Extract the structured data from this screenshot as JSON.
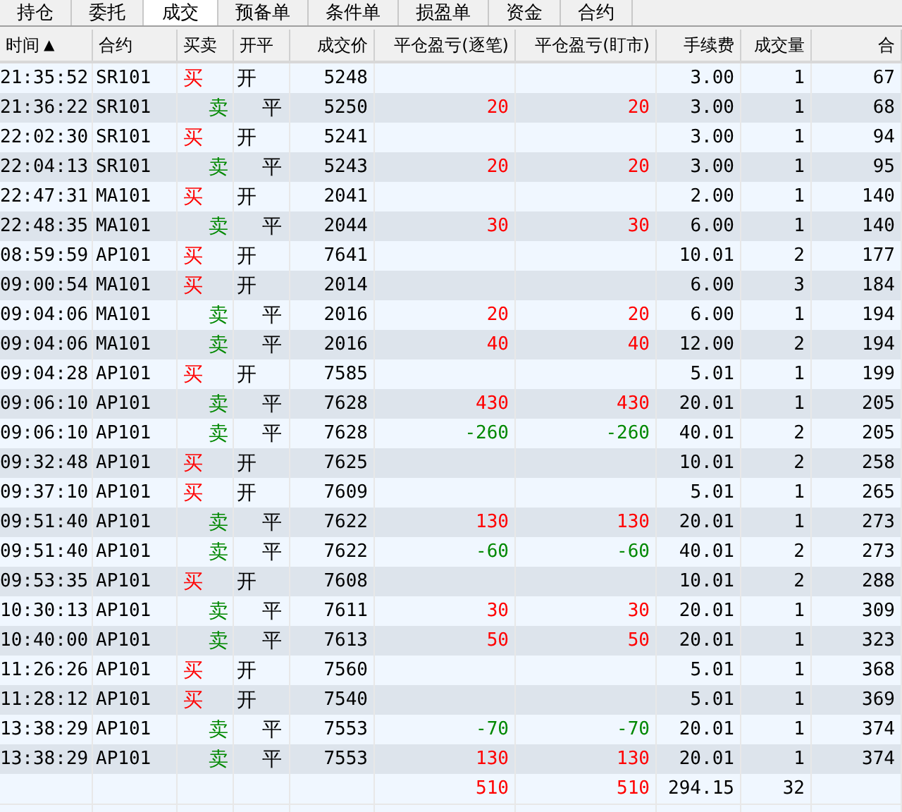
{
  "tabs": [
    {
      "label": "持仓",
      "selected": false
    },
    {
      "label": "委托",
      "selected": false
    },
    {
      "label": "成交",
      "selected": true
    },
    {
      "label": "预备单",
      "selected": false
    },
    {
      "label": "条件单",
      "selected": false
    },
    {
      "label": "损盈单",
      "selected": false
    },
    {
      "label": "资金",
      "selected": false
    },
    {
      "label": "合约",
      "selected": false
    }
  ],
  "table": {
    "columns": [
      {
        "label": "时间",
        "sort_mark": "▲"
      },
      {
        "label": "合约"
      },
      {
        "label": "买卖"
      },
      {
        "label": "开平"
      },
      {
        "label": "成交价"
      },
      {
        "label": "平仓盈亏(逐笔)"
      },
      {
        "label": "平仓盈亏(盯市)"
      },
      {
        "label": "手续费"
      },
      {
        "label": "成交量"
      },
      {
        "label": "合"
      }
    ],
    "rows": [
      {
        "kind": "buy",
        "time": "21:35:52",
        "contract": "SR101",
        "side": "买",
        "offset": "开",
        "price": "5248",
        "fee": "3.00",
        "volume": "1",
        "column_10": "67"
      },
      {
        "kind": "sell",
        "time": "21:36:22",
        "contract": "SR101",
        "side": "卖",
        "offset": "平",
        "price": "5250",
        "pnl_trade": "20",
        "pnl_mark": "20",
        "color": "#ff0000",
        "fee": "3.00",
        "volume": "1",
        "column_10": "68"
      },
      {
        "kind": "buy",
        "time": "22:02:30",
        "contract": "SR101",
        "side": "买",
        "offset": "开",
        "price": "5241",
        "fee": "3.00",
        "volume": "1",
        "column_10": "94"
      },
      {
        "kind": "sell",
        "time": "22:04:13",
        "contract": "SR101",
        "side": "卖",
        "offset": "平",
        "price": "5243",
        "pnl_trade": "20",
        "pnl_mark": "20",
        "color": "#ff0000",
        "fee": "3.00",
        "volume": "1",
        "column_10": "95"
      },
      {
        "kind": "buy",
        "time": "22:47:31",
        "contract": "MA101",
        "side": "买",
        "offset": "开",
        "price": "2041",
        "fee": "2.00",
        "volume": "1",
        "column_10": "140"
      },
      {
        "kind": "sell",
        "time": "22:48:35",
        "contract": "MA101",
        "side": "卖",
        "offset": "平",
        "price": "2044",
        "pnl_trade": "30",
        "pnl_mark": "30",
        "color": "#ff0000",
        "fee": "6.00",
        "volume": "1",
        "column_10": "140"
      },
      {
        "kind": "buy",
        "time": "08:59:59",
        "contract": "AP101",
        "side": "买",
        "offset": "开",
        "price": "7641",
        "fee": "10.01",
        "volume": "2",
        "column_10": "177"
      },
      {
        "kind": "buy",
        "time": "09:00:54",
        "contract": "MA101",
        "side": "买",
        "offset": "开",
        "price": "2014",
        "fee": "6.00",
        "volume": "3",
        "column_10": "184"
      },
      {
        "kind": "sell",
        "time": "09:04:06",
        "contract": "MA101",
        "side": "卖",
        "offset": "平",
        "price": "2016",
        "pnl_trade": "20",
        "pnl_mark": "20",
        "color": "#ff0000",
        "fee": "6.00",
        "volume": "1",
        "column_10": "194"
      },
      {
        "kind": "sell",
        "time": "09:04:06",
        "contract": "MA101",
        "side": "卖",
        "offset": "平",
        "price": "2016",
        "pnl_trade": "40",
        "pnl_mark": "40",
        "color": "#ff0000",
        "fee": "12.00",
        "volume": "2",
        "column_10": "194"
      },
      {
        "kind": "buy",
        "time": "09:04:28",
        "contract": "AP101",
        "side": "买",
        "offset": "开",
        "price": "7585",
        "fee": "5.01",
        "volume": "1",
        "column_10": "199"
      },
      {
        "kind": "sell",
        "time": "09:06:10",
        "contract": "AP101",
        "side": "卖",
        "offset": "平",
        "price": "7628",
        "pnl_trade": "430",
        "pnl_mark": "430",
        "color": "#ff0000",
        "fee": "20.01",
        "volume": "1",
        "column_10": "205"
      },
      {
        "kind": "sell",
        "time": "09:06:10",
        "contract": "AP101",
        "side": "卖",
        "offset": "平",
        "price": "7628",
        "pnl_trade": "-260",
        "pnl_mark": "-260",
        "color": "#008800",
        "fee": "40.01",
        "volume": "2",
        "column_10": "205"
      },
      {
        "kind": "buy",
        "time": "09:32:48",
        "contract": "AP101",
        "side": "买",
        "offset": "开",
        "price": "7625",
        "fee": "10.01",
        "volume": "2",
        "column_10": "258"
      },
      {
        "kind": "buy",
        "time": "09:37:10",
        "contract": "AP101",
        "side": "买",
        "offset": "开",
        "price": "7609",
        "fee": "5.01",
        "volume": "1",
        "column_10": "265"
      },
      {
        "kind": "sell",
        "time": "09:51:40",
        "contract": "AP101",
        "side": "卖",
        "offset": "平",
        "price": "7622",
        "pnl_trade": "130",
        "pnl_mark": "130",
        "color": "#ff0000",
        "fee": "20.01",
        "volume": "1",
        "column_10": "273"
      },
      {
        "kind": "sell",
        "time": "09:51:40",
        "contract": "AP101",
        "side": "卖",
        "offset": "平",
        "price": "7622",
        "pnl_trade": "-60",
        "pnl_mark": "-60",
        "color": "#008800",
        "fee": "40.01",
        "volume": "2",
        "column_10": "273"
      },
      {
        "kind": "buy",
        "time": "09:53:35",
        "contract": "AP101",
        "side": "买",
        "offset": "开",
        "price": "7608",
        "fee": "10.01",
        "volume": "2",
        "column_10": "288"
      },
      {
        "kind": "sell",
        "time": "10:30:13",
        "contract": "AP101",
        "side": "卖",
        "offset": "平",
        "price": "7611",
        "pnl_trade": "30",
        "pnl_mark": "30",
        "color": "#ff0000",
        "fee": "20.01",
        "volume": "1",
        "column_10": "309"
      },
      {
        "kind": "sell",
        "time": "10:40:00",
        "contract": "AP101",
        "side": "卖",
        "offset": "平",
        "price": "7613",
        "pnl_trade": "50",
        "pnl_mark": "50",
        "color": "#ff0000",
        "fee": "20.01",
        "volume": "1",
        "column_10": "323"
      },
      {
        "kind": "buy",
        "time": "11:26:26",
        "contract": "AP101",
        "side": "买",
        "offset": "开",
        "price": "7560",
        "fee": "5.01",
        "volume": "1",
        "column_10": "368"
      },
      {
        "kind": "buy",
        "time": "11:28:12",
        "contract": "AP101",
        "side": "买",
        "offset": "开",
        "price": "7540",
        "fee": "5.01",
        "volume": "1",
        "column_10": "369"
      },
      {
        "kind": "sell",
        "time": "13:38:29",
        "contract": "AP101",
        "side": "卖",
        "offset": "平",
        "price": "7553",
        "pnl_trade": "-70",
        "pnl_mark": "-70",
        "color": "#008800",
        "fee": "20.01",
        "volume": "1",
        "column_10": "374"
      },
      {
        "kind": "sell",
        "time": "13:38:29",
        "contract": "AP101",
        "side": "卖",
        "offset": "平",
        "price": "7553",
        "pnl_trade": "130",
        "pnl_mark": "130",
        "color": "#ff0000",
        "fee": "20.01",
        "volume": "1",
        "column_10": "374"
      }
    ],
    "totals": {
      "pnl_trade": "510",
      "pnl_mark": "510",
      "color": "#ff0000",
      "fee": "294.15",
      "volume": "32"
    }
  }
}
